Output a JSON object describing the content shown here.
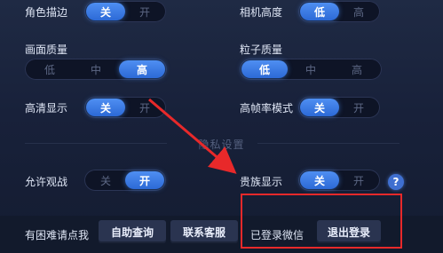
{
  "settings": {
    "row1": {
      "left": {
        "label": "角色描边",
        "options": [
          "关",
          "开"
        ],
        "selected": 0
      },
      "right": {
        "label": "相机高度",
        "options": [
          "低",
          "高"
        ],
        "selected": 0
      }
    },
    "row2": {
      "left": {
        "label": "画面质量",
        "options": [
          "低",
          "中",
          "高"
        ],
        "selected": 2
      },
      "right": {
        "label": "粒子质量",
        "options": [
          "低",
          "中",
          "高"
        ],
        "selected": 0
      }
    },
    "row3": {
      "left": {
        "label": "高清显示",
        "options": [
          "关",
          "开"
        ],
        "selected": 0
      },
      "right": {
        "label": "高帧率模式",
        "options": [
          "关",
          "开"
        ],
        "selected": 0
      }
    }
  },
  "privacy": {
    "title": "隐私设置",
    "left": {
      "label": "允许观战",
      "options": [
        "关",
        "开"
      ],
      "selected": 1
    },
    "right": {
      "label": "贵族显示",
      "options": [
        "关",
        "开"
      ],
      "selected": 0
    },
    "help_symbol": "?"
  },
  "bottom": {
    "help_text": "有困难请点我",
    "self_service_button": "自助查询",
    "contact_button": "联系客服",
    "login_status": "已登录微信",
    "logout_button": "退出登录"
  },
  "colors": {
    "active_toggle": "#3a7be6",
    "annotation": "#e8292a",
    "background": "#1b2440"
  }
}
